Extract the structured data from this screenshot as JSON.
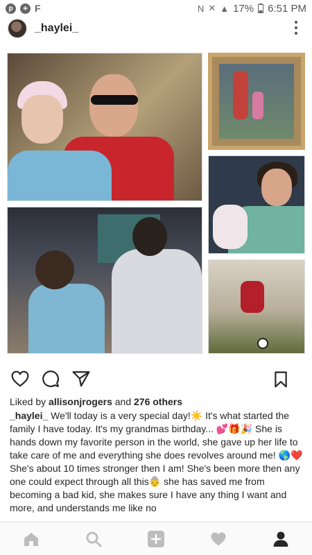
{
  "status_bar": {
    "pin_glyph": "p",
    "plus_glyph": "+",
    "f_glyph": "F",
    "nfc_glyph": "N",
    "mute_glyph": "✕",
    "signal_glyph": "▲",
    "battery": "17%",
    "time": "6:51 PM"
  },
  "header": {
    "username": "_haylei_",
    "more_icon": "more-vertical-icon"
  },
  "actions": {
    "like_icon": "heart-icon",
    "comment_icon": "comment-icon",
    "share_icon": "send-icon",
    "save_icon": "bookmark-icon"
  },
  "likes": {
    "prefix": "Liked by ",
    "user": "allisonjrogers",
    "middle": " and ",
    "count": "276 others"
  },
  "caption": {
    "author": "_haylei_",
    "text": " We'll today is a very special day!☀️ It's what started the family I have today. It's my grandmas birthday... 💕🎁🎉 She is hands down my favorite person in the world, she gave up her life to take care of me and everything she does revolves around me! 🌎❤️ She's about 10 times stronger then I am! She's been more then any one could expect through all this👵 she has saved me from becoming a bad kid, she makes sure I have any thing I want and more, and understands me like no"
  },
  "bottom_nav": {
    "items": [
      "home-icon",
      "search-icon",
      "add-post-icon",
      "activity-heart-icon",
      "profile-icon"
    ]
  },
  "colors": {
    "text": "#262626",
    "nav_bg": "#fafafa",
    "icon": "#262626",
    "icon_inactive": "#bdbdbd"
  }
}
